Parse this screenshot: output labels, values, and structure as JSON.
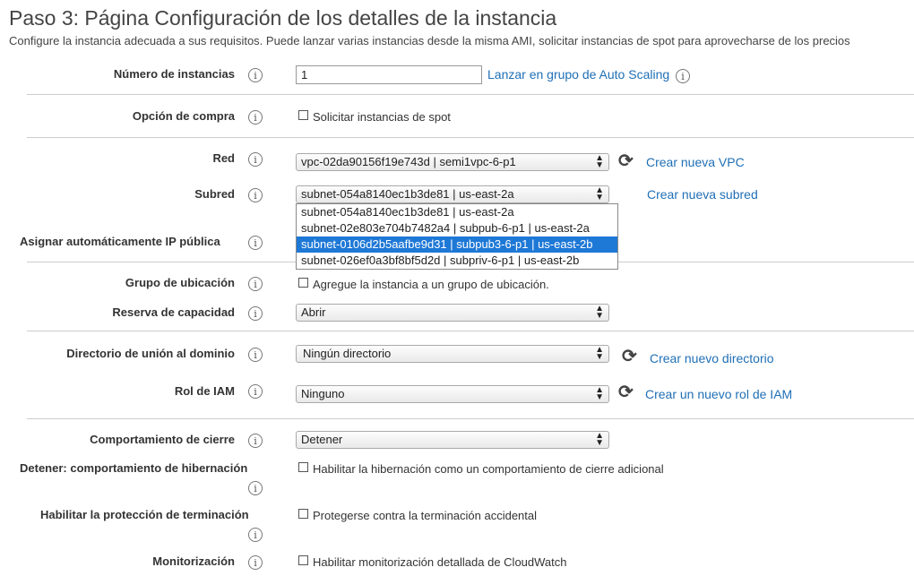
{
  "header": {
    "title": "Paso 3: Página Configuración de los detalles de la instancia",
    "subtitle": "Configure la instancia adecuada a sus requisitos. Puede lanzar varias instancias desde la misma AMI, solicitar instancias de spot para aprovecharse de los precios"
  },
  "info_glyph": "i",
  "fields": {
    "num_instances": {
      "label": "Número de instancias",
      "value": "1",
      "link": "Lanzar en grupo de Auto Scaling"
    },
    "purchase_option": {
      "label": "Opción de compra",
      "checkbox": "Solicitar instancias de spot"
    },
    "network": {
      "label": "Red",
      "value": "vpc-02da90156f19e743d | semi1vpc-6-p1",
      "link": "Crear nueva VPC"
    },
    "subnet": {
      "label": "Subred",
      "value": "subnet-054a8140ec1b3de81 | us-east-2a",
      "link": "Crear nueva subred",
      "options": [
        "subnet-054a8140ec1b3de81 | us-east-2a",
        "subnet-02e803e704b7482a4 | subpub-6-p1 | us-east-2a",
        "subnet-0106d2b5aafbe9d31 | subpub3-6-p1 | us-east-2b",
        "subnet-026ef0a3bf8bf5d2d | subpriv-6-p1 | us-east-2b"
      ],
      "highlighted_index": 2
    },
    "auto_public_ip": {
      "label": "Asignar automáticamente IP pública"
    },
    "placement_group": {
      "label": "Grupo de ubicación",
      "checkbox": "Agregue la instancia a un grupo de ubicación."
    },
    "capacity_reservation": {
      "label": "Reserva de capacidad",
      "value": "Abrir"
    },
    "domain_join": {
      "label": "Directorio de unión al dominio",
      "value": "Ningún directorio",
      "link": "Crear nuevo directorio"
    },
    "iam_role": {
      "label": "Rol de IAM",
      "value": "Ninguno",
      "link": "Crear un nuevo rol de IAM"
    },
    "shutdown_behavior": {
      "label": "Comportamiento de cierre",
      "value": "Detener"
    },
    "hibernate_behavior": {
      "label": "Detener: comportamiento de hibernación",
      "checkbox": "Habilitar la hibernación como un comportamiento de cierre adicional"
    },
    "termination_protection": {
      "label": "Habilitar la protección de terminación",
      "checkbox": "Protegerse contra la terminación accidental"
    },
    "monitoring": {
      "label": "Monitorización",
      "checkbox": "Habilitar monitorización detallada de CloudWatch"
    }
  },
  "colors": {
    "link": "#1f6fb5",
    "highlight": "#1e78d6"
  }
}
